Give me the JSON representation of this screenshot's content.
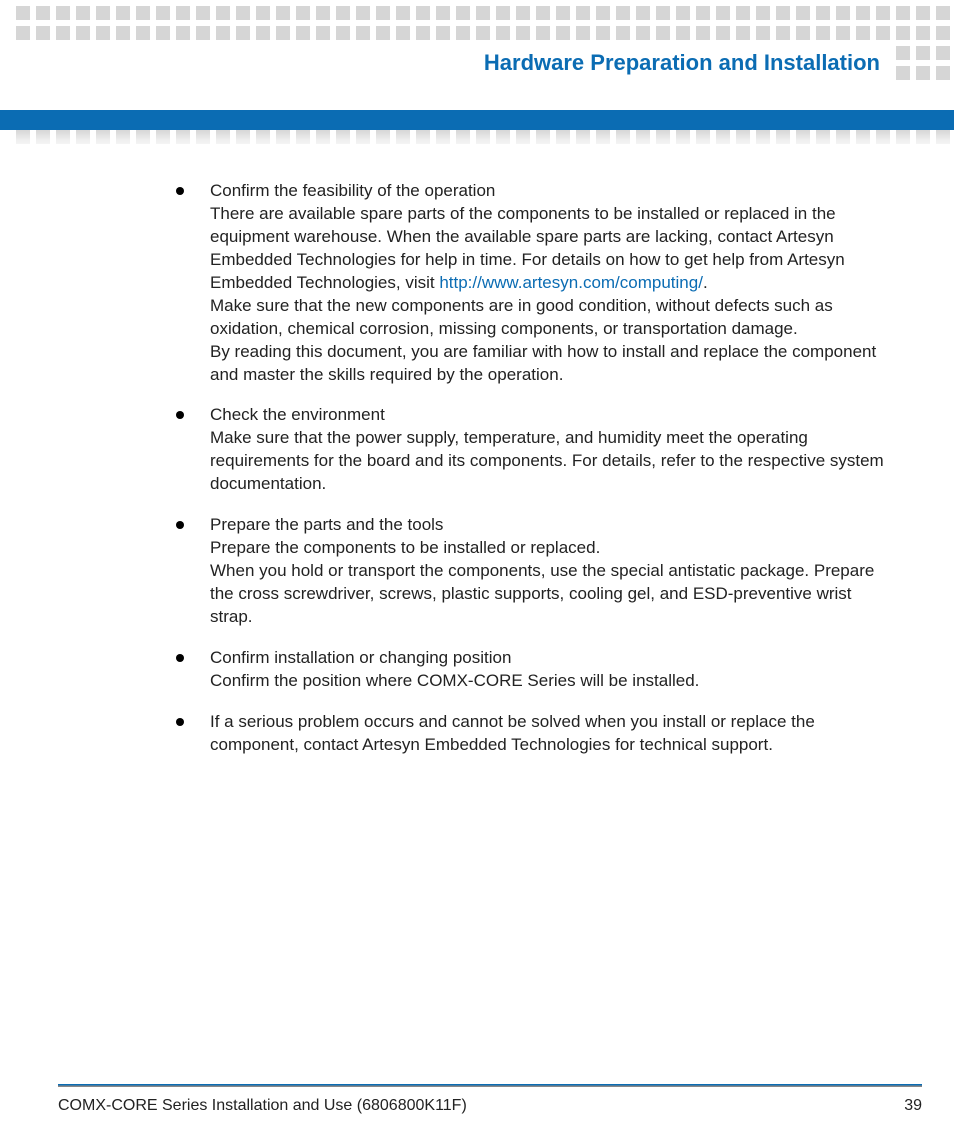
{
  "header": {
    "title": "Hardware Preparation and Installation"
  },
  "link": {
    "url_text": "http://www.artesyn.com/computing/"
  },
  "bullets": [
    {
      "lead": "Confirm the feasibility of the operation",
      "body_pre": "There are available spare parts of the components to be installed or replaced in the equipment warehouse. When the available spare parts are lacking, contact Artesyn Embedded Technologies for help in time. For details on how to get help from Artesyn Embedded Technologies, visit ",
      "body_post": ".\nMake sure that the new components are in good condition, without defects such as oxidation, chemical corrosion, missing components, or transportation damage.\nBy reading this document, you are familiar with how to install and replace the component and master the skills required by the operation."
    },
    {
      "lead": "Check the environment",
      "body": "Make sure that the power supply, temperature, and humidity meet the operating requirements for the board and its components. For details, refer to the respective system documentation."
    },
    {
      "lead": "Prepare the parts and the tools",
      "body": "Prepare the components to be installed or replaced.\nWhen you hold or transport the components, use the special antistatic package. Prepare the cross screwdriver, screws, plastic supports, cooling gel, and ESD-preventive wrist strap."
    },
    {
      "lead": "Confirm installation or changing position",
      "body": "Confirm the position where COMX-CORE Series will be installed."
    },
    {
      "lead": "",
      "body": "If a serious problem occurs and cannot be solved when you install or replace the component, contact Artesyn Embedded Technologies for technical support."
    }
  ],
  "footer": {
    "doc_title": "COMX-CORE Series Installation and Use (6806800K11F)",
    "page_number": "39"
  }
}
